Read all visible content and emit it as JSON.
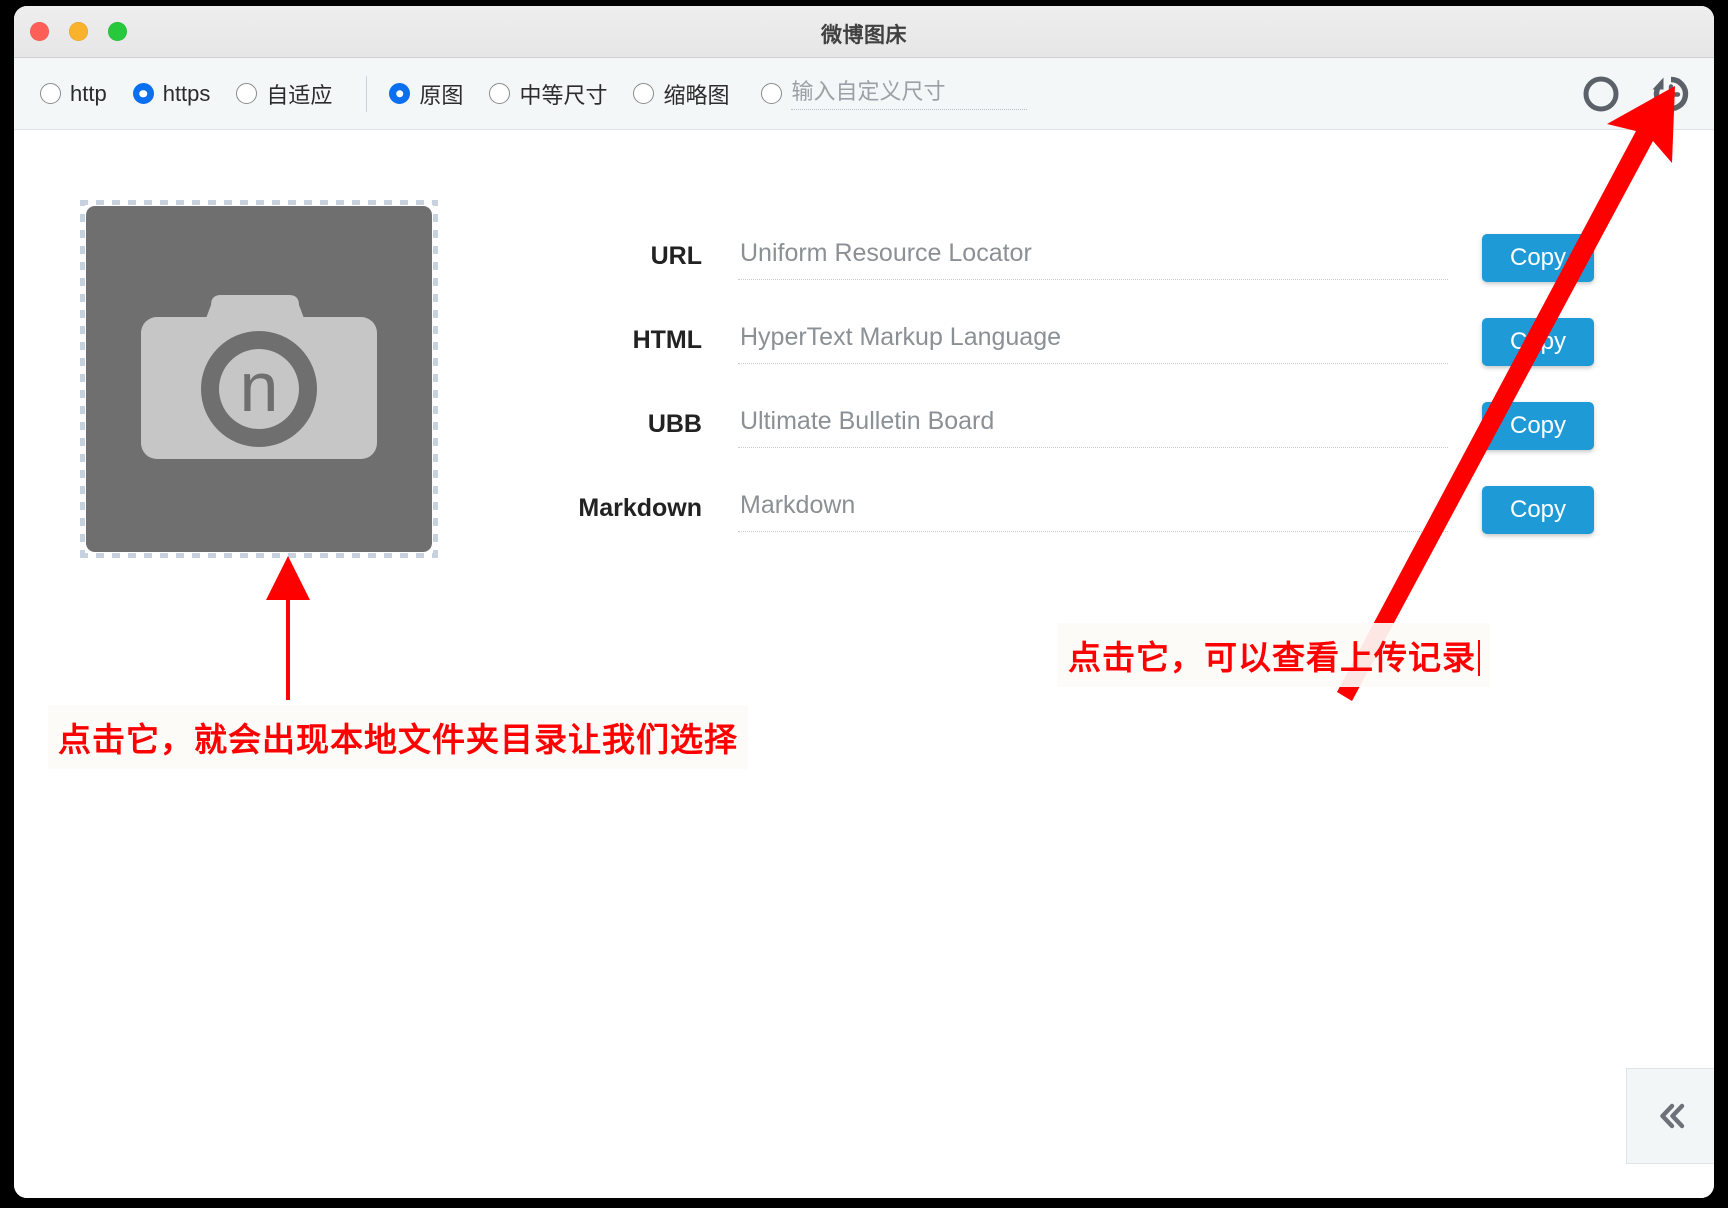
{
  "window": {
    "title": "微博图床",
    "traffic_lights": [
      "close-button",
      "minimize-button",
      "maximize-button"
    ]
  },
  "toolbar": {
    "protocol_group": [
      {
        "label": "http",
        "selected": false
      },
      {
        "label": "https",
        "selected": true
      },
      {
        "label": "自适应",
        "selected": false
      }
    ],
    "size_group": [
      {
        "label": "原图",
        "selected": true
      },
      {
        "label": "中等尺寸",
        "selected": false
      },
      {
        "label": "缩略图",
        "selected": false
      }
    ],
    "custom_size": {
      "selected": false,
      "placeholder": "输入自定义尺寸",
      "value": ""
    },
    "icons": [
      {
        "name": "circle-icon",
        "label": ""
      },
      {
        "name": "history-icon",
        "label": ""
      }
    ]
  },
  "main": {
    "dropzone": {
      "icon": "camera-icon",
      "lens_letter": "n"
    },
    "fields": [
      {
        "label": "URL",
        "placeholder": "Uniform Resource Locator",
        "value": "",
        "button": "Copy"
      },
      {
        "label": "HTML",
        "placeholder": "HyperText Markup Language",
        "value": "",
        "button": "Copy"
      },
      {
        "label": "UBB",
        "placeholder": "Ultimate Bulletin Board",
        "value": "",
        "button": "Copy"
      },
      {
        "label": "Markdown",
        "placeholder": "Markdown",
        "value": "",
        "button": "Copy"
      }
    ],
    "collapse_button": {
      "icon": "double-chevron-left-icon"
    }
  },
  "annotations": {
    "accent_color": "#ff0000",
    "note_dropzone": "点击它，就会出现本地文件夹目录让我们选择",
    "note_history": "点击它，可以查看上传记录"
  },
  "colors": {
    "radio_accent": "#0a6ff0",
    "copy_button": "#1e9bd7",
    "toolbar_bg": "#f4f7f8",
    "dropzone_fill": "#6f6f6f"
  }
}
